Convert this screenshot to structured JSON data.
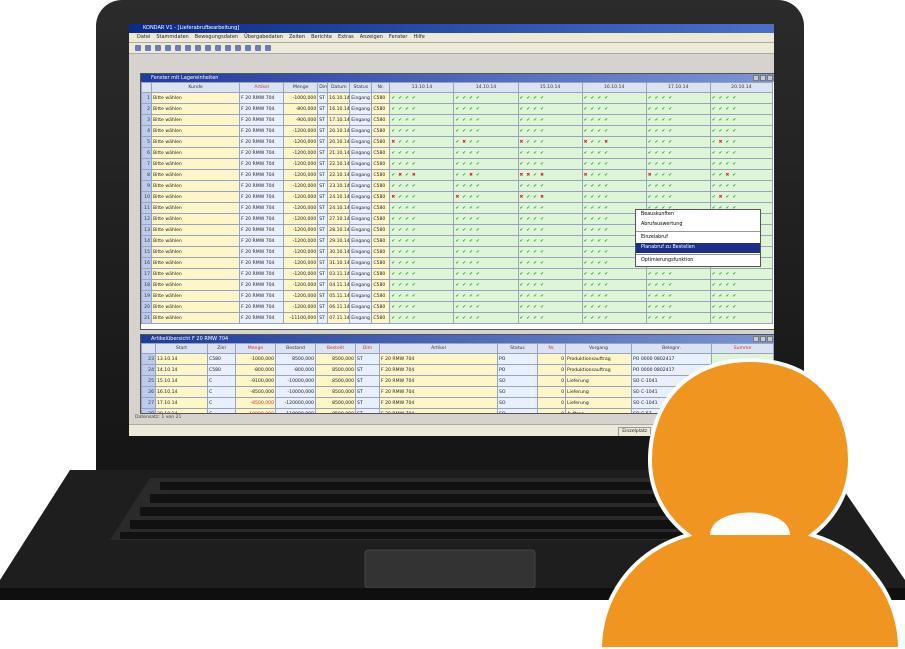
{
  "app": {
    "title": "KONDAR V1 - [Lieferabrufbearbeitung]",
    "menu": [
      "Datei",
      "Stammdaten",
      "Bewegungsdaten",
      "Übergabedaten",
      "Zeiten",
      "Berichte",
      "Extras",
      "Anzeigen",
      "Fenster",
      "Hilfe"
    ]
  },
  "panel_top": {
    "title": "Fenster mit Lagereinheiten",
    "headers": [
      "Kunde",
      "Artikel",
      "Menge",
      "Dim",
      "Datum",
      "Status",
      "Nr.",
      "13.10.14",
      "14.10.14",
      "15.10.14",
      "16.10.14",
      "17.10.14",
      "20.10.14"
    ],
    "rows": [
      {
        "kunde": "Bitte wählen",
        "artikel": "F 20 RMW 704",
        "menge": "-1000,000",
        "dim": "ST",
        "datum": "16.10.14",
        "status": "Eingang",
        "nr": "C580",
        "marks": "ccccccccccccccccccccc"
      },
      {
        "kunde": "Bitte wählen",
        "artikel": "F 20 RMW 704",
        "menge": "-800,000",
        "dim": "ST",
        "datum": "16.10.14",
        "status": "Eingang",
        "nr": "C580",
        "marks": "ccccccccccccccccccccc"
      },
      {
        "kunde": "Bitte wählen",
        "artikel": "F 20 RMW 704",
        "menge": "-900,000",
        "dim": "ST",
        "datum": "17.10.14",
        "status": "Eingang",
        "nr": "C580",
        "marks": "ccccccccccccccccccccc"
      },
      {
        "kunde": "Bitte wählen",
        "artikel": "F 20 RMW 704",
        "menge": "-1200,000",
        "dim": "ST",
        "datum": "20.10.14",
        "status": "Eingang",
        "nr": "C580",
        "marks": "ccccccccccccccccccccc"
      },
      {
        "kunde": "Bitte wählen",
        "artikel": "F 20 RMW 704",
        "menge": "-1200,000",
        "dim": "ST",
        "datum": "20.10.14",
        "status": "Eingang",
        "nr": "C580",
        "marks": "xccccxccxcccxccxccccc"
      },
      {
        "kunde": "Bitte wählen",
        "artikel": "F 20 RMW 704",
        "menge": "-1200,000",
        "dim": "ST",
        "datum": "21.10.14",
        "status": "Eingang",
        "nr": "C580",
        "marks": "ccccccccccccccccccccc"
      },
      {
        "kunde": "Bitte wählen",
        "artikel": "F 20 RMW 704",
        "menge": "-1200,000",
        "dim": "ST",
        "datum": "22.10.14",
        "status": "Eingang",
        "nr": "C580",
        "marks": "ccccccccccccccccccccc"
      },
      {
        "kunde": "Bitte wählen",
        "artikel": "F 20 RMW 704",
        "menge": "-1200,000",
        "dim": "ST",
        "datum": "22.10.14",
        "status": "Eingang",
        "nr": "C580",
        "marks": "cxcxccxcxxcxxcccxcccc"
      },
      {
        "kunde": "Bitte wählen",
        "artikel": "F 20 RMW 704",
        "menge": "-1200,000",
        "dim": "ST",
        "datum": "23.10.14",
        "status": "Eingang",
        "nr": "C580",
        "marks": "ccccccccccccccccccccc"
      },
      {
        "kunde": "Bitte wählen",
        "artikel": "F 20 RMW 704",
        "menge": "-1200,000",
        "dim": "ST",
        "datum": "24.10.14",
        "status": "Eingang",
        "nr": "C580",
        "marks": "xcccxcccxccxccccccccc"
      },
      {
        "kunde": "Bitte wählen",
        "artikel": "F 20 RMW 704",
        "menge": "-1200,000",
        "dim": "ST",
        "datum": "24.10.14",
        "status": "Eingang",
        "nr": "C580",
        "marks": "ccccccccccccccccccccc"
      },
      {
        "kunde": "Bitte wählen",
        "artikel": "F 20 RMW 704",
        "menge": "-1200,000",
        "dim": "ST",
        "datum": "27.10.14",
        "status": "Eingang",
        "nr": "C580",
        "marks": "ccccccccccccccccccccc"
      },
      {
        "kunde": "Bitte wählen",
        "artikel": "F 20 RMW 704",
        "menge": "-1200,000",
        "dim": "ST",
        "datum": "28.10.14",
        "status": "Eingang",
        "nr": "C580",
        "marks": "ccccccccccccccccccccc"
      },
      {
        "kunde": "Bitte wählen",
        "artikel": "F 20 RMW 704",
        "menge": "-1200,000",
        "dim": "ST",
        "datum": "29.10.14",
        "status": "Eingang",
        "nr": "C580",
        "marks": "ccccccccccccccccccccc"
      },
      {
        "kunde": "Bitte wählen",
        "artikel": "F 20 RMW 704",
        "menge": "-1200,000",
        "dim": "ST",
        "datum": "30.10.14",
        "status": "Eingang",
        "nr": "C580",
        "marks": "ccccccccccccccccccccc"
      },
      {
        "kunde": "Bitte wählen",
        "artikel": "F 20 RMW 704",
        "menge": "-1200,000",
        "dim": "ST",
        "datum": "31.10.14",
        "status": "Eingang",
        "nr": "C580",
        "marks": "ccccccccccccccccccccc"
      },
      {
        "kunde": "Bitte wählen",
        "artikel": "F 20 RMW 704",
        "menge": "-1200,000",
        "dim": "ST",
        "datum": "03.11.14",
        "status": "Eingang",
        "nr": "C580",
        "marks": "ccccccccccccccccccccc"
      },
      {
        "kunde": "Bitte wählen",
        "artikel": "F 20 RMW 704",
        "menge": "-1200,000",
        "dim": "ST",
        "datum": "04.11.14",
        "status": "Eingang",
        "nr": "C580",
        "marks": "ccccccccccccccccccccc"
      },
      {
        "kunde": "Bitte wählen",
        "artikel": "F 20 RMW 704",
        "menge": "-1200,000",
        "dim": "ST",
        "datum": "05.11.14",
        "status": "Eingang",
        "nr": "C580",
        "marks": "ccccccccccccccccccccc"
      },
      {
        "kunde": "Bitte wählen",
        "artikel": "F 20 RMW 704",
        "menge": "-1200,000",
        "dim": "ST",
        "datum": "06.11.14",
        "status": "Eingang",
        "nr": "C580",
        "marks": "ccccccccccccccccccccc"
      },
      {
        "kunde": "Bitte wählen",
        "artikel": "F 20 RMW 704",
        "menge": "-11100,000",
        "dim": "ST",
        "datum": "07.11.14",
        "status": "Eingang",
        "nr": "C580",
        "marks": "ccccccccccccccccccccc"
      }
    ]
  },
  "context_menu": {
    "items": [
      "Beauskunften",
      "Abrufauswertung",
      "Einzelabruf",
      "Planabruf zu Bestellen",
      "Optimierungsfunktion"
    ],
    "selected_index": 3
  },
  "panel_bottom": {
    "title": "Artikelübersicht F 20 RMW 704",
    "headers": [
      "Start",
      "Ziel",
      "Menge",
      "Bestand",
      "Bestellt",
      "Dim",
      "Artikel",
      "Status",
      "Nr.",
      "Vorgang",
      "Belegnr.",
      "Summe"
    ],
    "rows": [
      {
        "n": "23",
        "start": "13.10.14",
        "ziel": "C580",
        "menge": "-1000,000",
        "bestand": "8500,000",
        "bestellt": "8500,000",
        "dim": "ST",
        "artikel": "F 20 RMW 704",
        "status": "PO",
        "nr": "0",
        "vorgang": "Produktionsauftrag",
        "beleg": "PO 0000 0802417"
      },
      {
        "n": "24",
        "start": "14.10.14",
        "ziel": "C580",
        "menge": "-800,000",
        "bestand": "-800,000",
        "bestellt": "8500,000",
        "dim": "ST",
        "artikel": "F 20 RMW 704",
        "status": "PO",
        "nr": "0",
        "vorgang": "Produktionsauftrag",
        "beleg": "PO 0000 0802417"
      },
      {
        "n": "25",
        "start": "15.10.14",
        "ziel": "C",
        "menge": "-9100,000",
        "bestand": "-10000,000",
        "bestellt": "8500,000",
        "dim": "ST",
        "artikel": "F 20 RMW 704",
        "status": "SO",
        "nr": "0",
        "vorgang": "Lieferung",
        "beleg": "SO C-1041"
      },
      {
        "n": "26",
        "start": "16.10.14",
        "ziel": "C",
        "menge": "-8500,000",
        "bestand": "-10000,000",
        "bestellt": "8500,000",
        "dim": "ST",
        "artikel": "F 20 RMW 704",
        "status": "SO",
        "nr": "0",
        "vorgang": "Lieferung",
        "beleg": "SO C-1041"
      },
      {
        "n": "27",
        "start": "17.10.14",
        "ziel": "C",
        "menge": "-8500,000",
        "bestand": "-120000,000",
        "bestellt": "8500,000",
        "dim": "ST",
        "artikel": "F 20 RMW 704",
        "status": "SO",
        "nr": "0",
        "vorgang": "Lieferung",
        "beleg": "SO C-1041"
      },
      {
        "n": "28",
        "start": "20.10.14",
        "ziel": "C",
        "menge": "-10000,000",
        "bestand": "-110000,000",
        "bestellt": "8500,000",
        "dim": "ST",
        "artikel": "F 20 RMW 704",
        "status": "SO",
        "nr": "0",
        "vorgang": "Auftrag",
        "beleg": "SO C-57"
      }
    ]
  },
  "status_bar": {
    "left": "Datensatz: 1 von 21",
    "items": [
      "Einzelplatz",
      "Mark. 1",
      "Bitte wählen",
      "Aktive Optionen"
    ]
  },
  "colors": {
    "person": "#f0951f",
    "titlebar": "#0b2a8a"
  }
}
